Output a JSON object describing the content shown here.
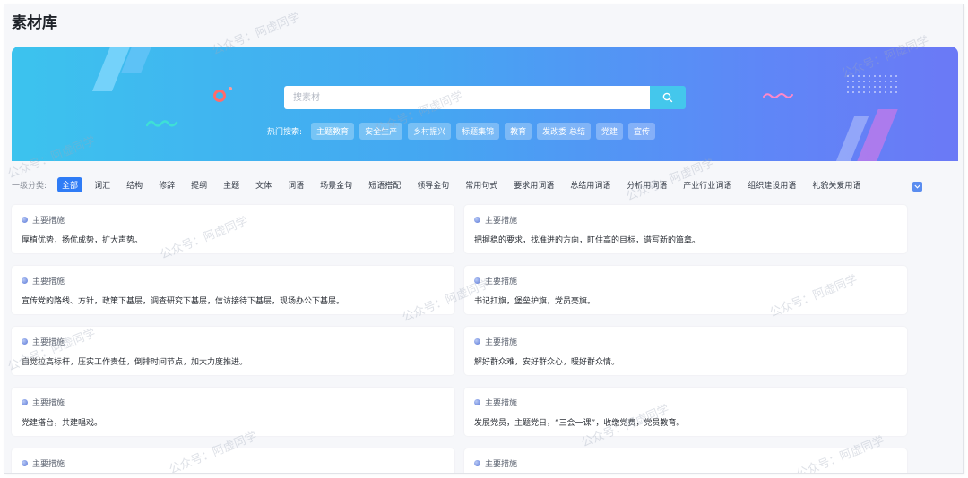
{
  "page": {
    "title": "素材库"
  },
  "colors": {
    "banner_start": "#3cc3ee",
    "banner_end": "#6b79f6",
    "accent": "#2f7cf6",
    "search_button": "#44c7ec"
  },
  "search": {
    "placeholder": "搜素材",
    "icon": "search-icon"
  },
  "hot_search": {
    "label": "热门搜索:",
    "tags": [
      "主题教育",
      "安全生产",
      "乡村振兴",
      "标题集锦",
      "教育",
      "发改委 总结",
      "党建",
      "宣传"
    ]
  },
  "categories": {
    "label": "一级分类:",
    "items": [
      "全部",
      "词汇",
      "结构",
      "修辞",
      "提纲",
      "主题",
      "文体",
      "词语",
      "场景金句",
      "短语搭配",
      "领导金句",
      "常用句式",
      "要求用词语",
      "总结用词语",
      "分析用词语",
      "产业行业词语",
      "组织建设用语",
      "礼貌关爱用语"
    ],
    "active_index": 0,
    "expand_icon": "chevron-down-icon"
  },
  "cards": [
    {
      "tag": "主要措施",
      "text": "厚植优势，扬优成势，扩大声势。"
    },
    {
      "tag": "主要措施",
      "text": "把握稳的要求，找准进的方向，盯住高的目标，谱写新的篇章。"
    },
    {
      "tag": "主要措施",
      "text": "宣传党的路线、方针，政策下基层，调查研究下基层，信访接待下基层，现场办公下基层。"
    },
    {
      "tag": "主要措施",
      "text": "书记扛旗，堡垒护旗，党员亮旗。"
    },
    {
      "tag": "主要措施",
      "text": "自觉拉高标杆，压实工作责任，倒排时间节点，加大力度推进。"
    },
    {
      "tag": "主要措施",
      "text": "解好群众难，安好群众心，暖好群众情。"
    },
    {
      "tag": "主要措施",
      "text": "党建搭台，共建唱戏。"
    },
    {
      "tag": "主要措施",
      "text": "发展党员，主题党日，“三会一课”，收缴党费，党员教育。"
    },
    {
      "tag": "主要措施",
      "text": ""
    },
    {
      "tag": "主要措施",
      "text": ""
    }
  ],
  "watermark": {
    "text": "公众号：阿虚同学"
  }
}
